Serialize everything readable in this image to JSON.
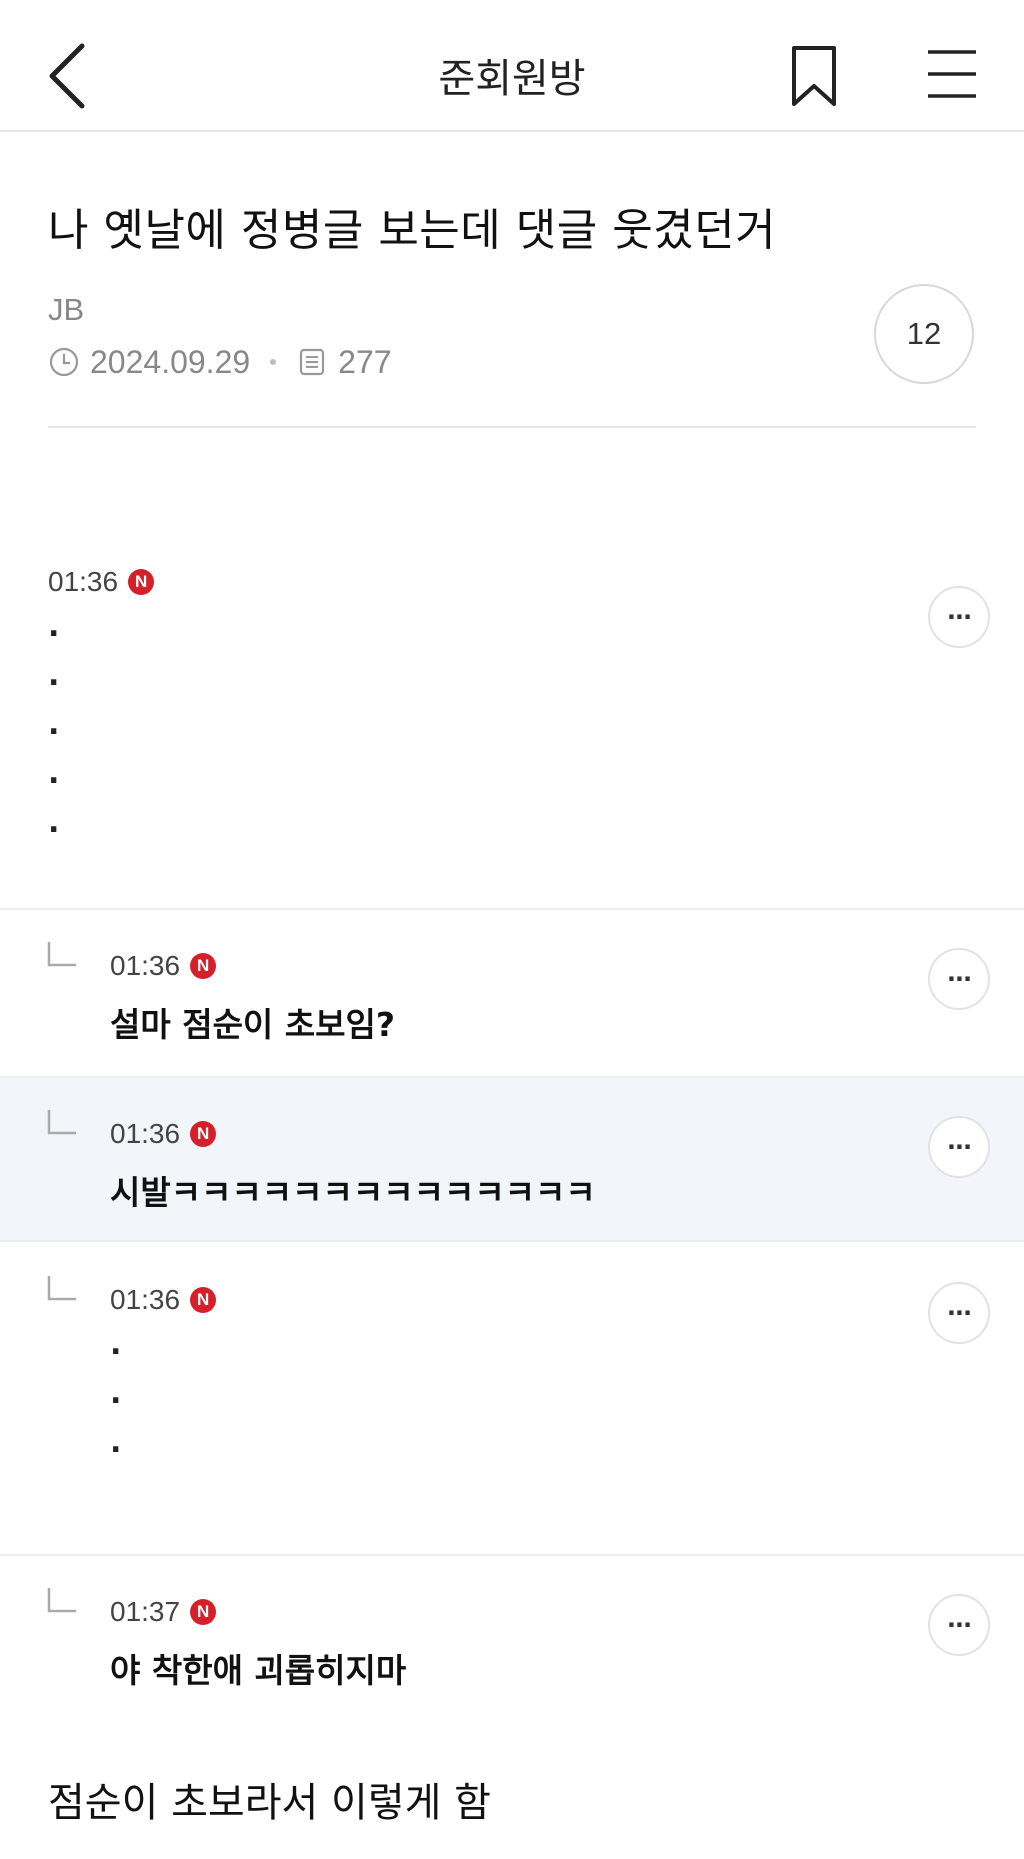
{
  "header": {
    "title": "준회원방",
    "back_icon": "chevron-left-icon",
    "bookmark_icon": "bookmark-icon",
    "menu_icon": "hamburger-menu-icon"
  },
  "post": {
    "title": "나 옛날에 정병글 보는데 댓글 웃겼던거",
    "author": "JB",
    "date": "2024.09.29",
    "views": "277",
    "comment_count": "12"
  },
  "comments": [
    {
      "time": "01:36",
      "badge": "N",
      "dots": [
        ".",
        ".",
        ".",
        ".",
        "."
      ]
    },
    {
      "time": "01:36",
      "badge": "N",
      "text": "설마 점순이 초보임?"
    },
    {
      "time": "01:36",
      "badge": "N",
      "text": "시발ㅋㅋㅋㅋㅋㅋㅋㅋㅋㅋㅋㅋㅋㅋ"
    },
    {
      "time": "01:36",
      "badge": "N",
      "dots": [
        ".",
        ".",
        "."
      ]
    },
    {
      "time": "01:37",
      "badge": "N",
      "text": "야 착한애 괴롭히지마"
    }
  ],
  "more_label": "···",
  "body_text": "점순이 초보라서 이렇게 함",
  "colors": {
    "badge": "#d5202a",
    "highlight_row": "#f2f6fb",
    "divider": "#e6e6e6"
  }
}
